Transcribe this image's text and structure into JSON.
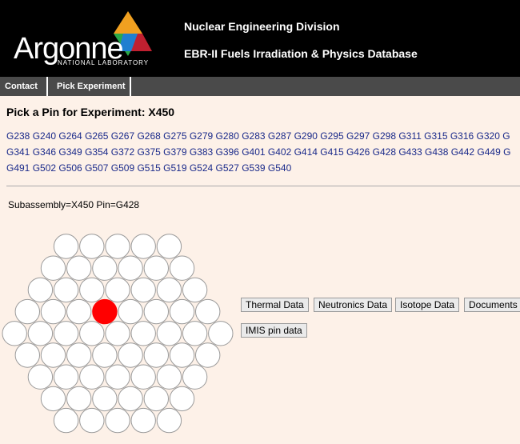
{
  "header": {
    "logo_text": "Argonne",
    "logo_sub": "NATIONAL LABORATORY",
    "division": "Nuclear Engineering Division",
    "database": "EBR-II Fuels Irradiation & Physics Database"
  },
  "nav": {
    "contact": "Contact",
    "pick_experiment": "Pick Experiment"
  },
  "title": "Pick a Pin for Experiment: X450",
  "pin_lines": [
    "G238 G240 G264 G265 G267 G268 G275 G279 G280 G283 G287 G290 G295 G297 G298 G311 G315 G316 G320 G",
    "G341 G346 G349 G354 G372 G375 G379 G383 G396 G401 G402 G414 G415 G426 G428 G433 G438 G442 G449 G",
    "G491 G502 G506 G507 G509 G515 G519 G524 G527 G539 G540"
  ],
  "subassembly_info": "Subassembly=X450 Pin=G428",
  "buttons": {
    "thermal": "Thermal Data",
    "neutronics": "Neutronics Data",
    "isotope": "Isotope Data",
    "documents": "Documents",
    "imis": "IMIS pin data"
  },
  "pin_grid": {
    "row_counts": [
      5,
      6,
      7,
      8,
      9,
      8,
      7,
      6,
      5
    ],
    "selected": {
      "row": 3,
      "col": 3
    },
    "selected_color": "#ff0000",
    "pin_color": "#ffffff"
  },
  "colors": {
    "header_bg": "#000000",
    "nav_bg": "#4a4a4a",
    "page_bg": "#fdf1e8",
    "link": "#1a2a8a"
  }
}
